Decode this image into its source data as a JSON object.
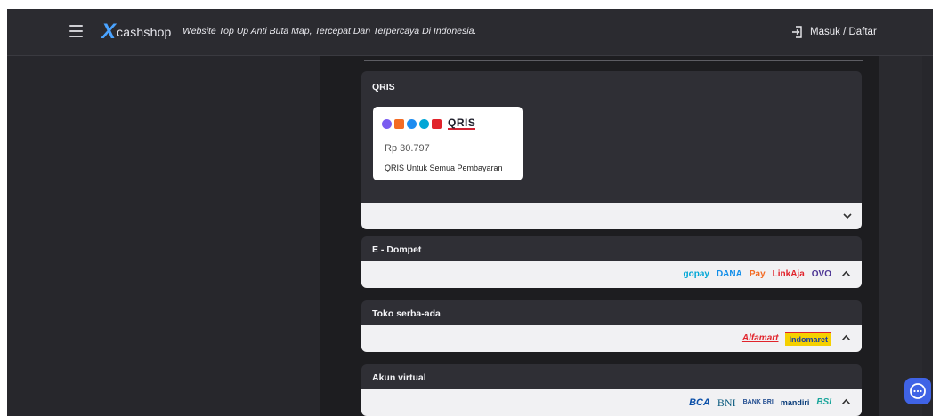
{
  "header": {
    "logo_text": "cashshop",
    "tagline": "Website Top Up Anti Buta Map, Tercepat Dan Terpercaya Di Indonesia.",
    "login_label": "Masuk / Daftar"
  },
  "sections": {
    "qris": {
      "title": "QRIS",
      "logo_word": "QRIS",
      "price": "Rp 30.797",
      "description": "QRIS Untuk Semua Pembayaran"
    },
    "ewallet": {
      "title": "E - Dompet",
      "brands": [
        "gopay",
        "DANA",
        "Pay",
        "LinkAja",
        "OVO"
      ]
    },
    "store": {
      "title": "Toko serba-ada",
      "brands": [
        "Alfamart",
        "Indomaret"
      ]
    },
    "va": {
      "title": "Akun virtual",
      "brands": [
        "BCA",
        "BNI",
        "BANK BRI",
        "mandiri",
        "BSI"
      ]
    }
  },
  "colors": {
    "accent": "#4aa3ff",
    "chat_button": "#3f63e6",
    "panel_bg": "#2f2f35",
    "bar_bg": "#f1f1f3"
  },
  "icons": [
    "menu-icon",
    "login-icon",
    "chevron-down-icon",
    "chevron-up-icon",
    "chat-icon"
  ]
}
